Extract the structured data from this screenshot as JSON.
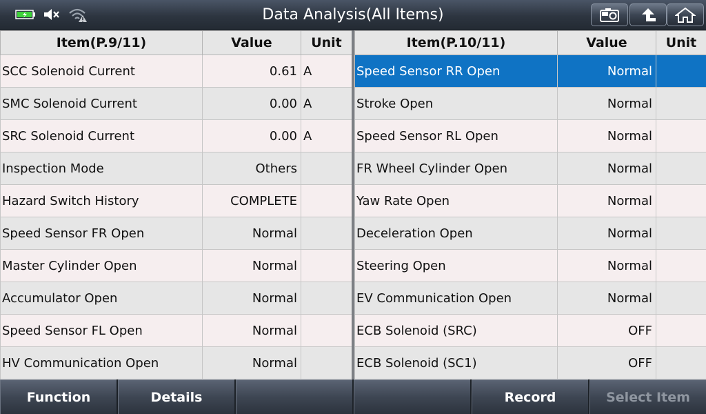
{
  "header": {
    "title": "Data Analysis(All Items)",
    "buttons": [
      {
        "name": "screenshot",
        "icon": "camera-icon"
      },
      {
        "name": "back",
        "icon": "arrow-up-icon"
      },
      {
        "name": "home",
        "icon": "home-icon"
      }
    ],
    "status_icons": [
      "battery-charging-icon",
      "speaker-muted-icon",
      "wifi-warning-icon"
    ]
  },
  "left_table": {
    "headers": {
      "item": "Item(P.9/11)",
      "value": "Value",
      "unit": "Unit"
    },
    "rows": [
      {
        "item": "SCC Solenoid Current",
        "value": "0.61",
        "unit": "A"
      },
      {
        "item": "SMC Solenoid Current",
        "value": "0.00",
        "unit": "A"
      },
      {
        "item": "SRC Solenoid Current",
        "value": "0.00",
        "unit": "A"
      },
      {
        "item": "Inspection Mode",
        "value": "Others",
        "unit": ""
      },
      {
        "item": "Hazard Switch History",
        "value": "COMPLETE",
        "unit": ""
      },
      {
        "item": "Speed Sensor FR Open",
        "value": "Normal",
        "unit": ""
      },
      {
        "item": "Master Cylinder Open",
        "value": "Normal",
        "unit": ""
      },
      {
        "item": "Accumulator Open",
        "value": "Normal",
        "unit": ""
      },
      {
        "item": "Speed Sensor FL Open",
        "value": "Normal",
        "unit": ""
      },
      {
        "item": "HV Communication Open",
        "value": "Normal",
        "unit": ""
      }
    ]
  },
  "right_table": {
    "headers": {
      "item": "Item(P.10/11)",
      "value": "Value",
      "unit": "Unit"
    },
    "selected_row": 0,
    "rows": [
      {
        "item": "Speed Sensor RR Open",
        "value": "Normal",
        "unit": ""
      },
      {
        "item": "Stroke Open",
        "value": "Normal",
        "unit": ""
      },
      {
        "item": "Speed Sensor RL Open",
        "value": "Normal",
        "unit": ""
      },
      {
        "item": "FR Wheel Cylinder Open",
        "value": "Normal",
        "unit": ""
      },
      {
        "item": "Yaw Rate Open",
        "value": "Normal",
        "unit": ""
      },
      {
        "item": "Deceleration Open",
        "value": "Normal",
        "unit": ""
      },
      {
        "item": "Steering Open",
        "value": "Normal",
        "unit": ""
      },
      {
        "item": "EV Communication Open",
        "value": "Normal",
        "unit": ""
      },
      {
        "item": "ECB Solenoid (SRC)",
        "value": "OFF",
        "unit": ""
      },
      {
        "item": "ECB Solenoid (SC1)",
        "value": "OFF",
        "unit": ""
      }
    ]
  },
  "bottom_bar": {
    "buttons": [
      {
        "label": "Function",
        "enabled": true
      },
      {
        "label": "Details",
        "enabled": true
      },
      {
        "label": "",
        "enabled": true
      },
      {
        "label": "",
        "enabled": true
      },
      {
        "label": "Record",
        "enabled": true
      },
      {
        "label": "Select Item",
        "enabled": false
      }
    ]
  },
  "colors": {
    "selected_row": "#0f73c4",
    "battery": "#3fd23a",
    "disabled_text": "#8f96a0"
  }
}
